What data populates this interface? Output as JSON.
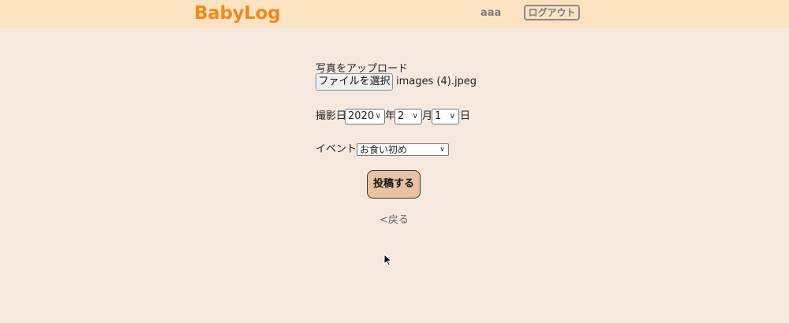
{
  "header": {
    "logo": "BabyLog",
    "username": "aaa",
    "logout_label": "ログアウト"
  },
  "upload": {
    "label": "写真をアップロード",
    "file_button_label": "ファイルを選択",
    "file_name": "images (4).jpeg"
  },
  "date": {
    "label": "撮影日",
    "year_value": "2020",
    "year_suffix": "年",
    "month_value": "2",
    "month_suffix": "月",
    "day_value": "1",
    "day_suffix": "日"
  },
  "event": {
    "label": "イベント",
    "selected": "お食い初め"
  },
  "actions": {
    "submit_label": "投稿する",
    "back_label": "<戻る"
  },
  "colors": {
    "page_background": "#f5e8df",
    "header_background": "#fbe3c2",
    "logo": "#f08a1c",
    "submit_background": "#e7c3a3"
  }
}
